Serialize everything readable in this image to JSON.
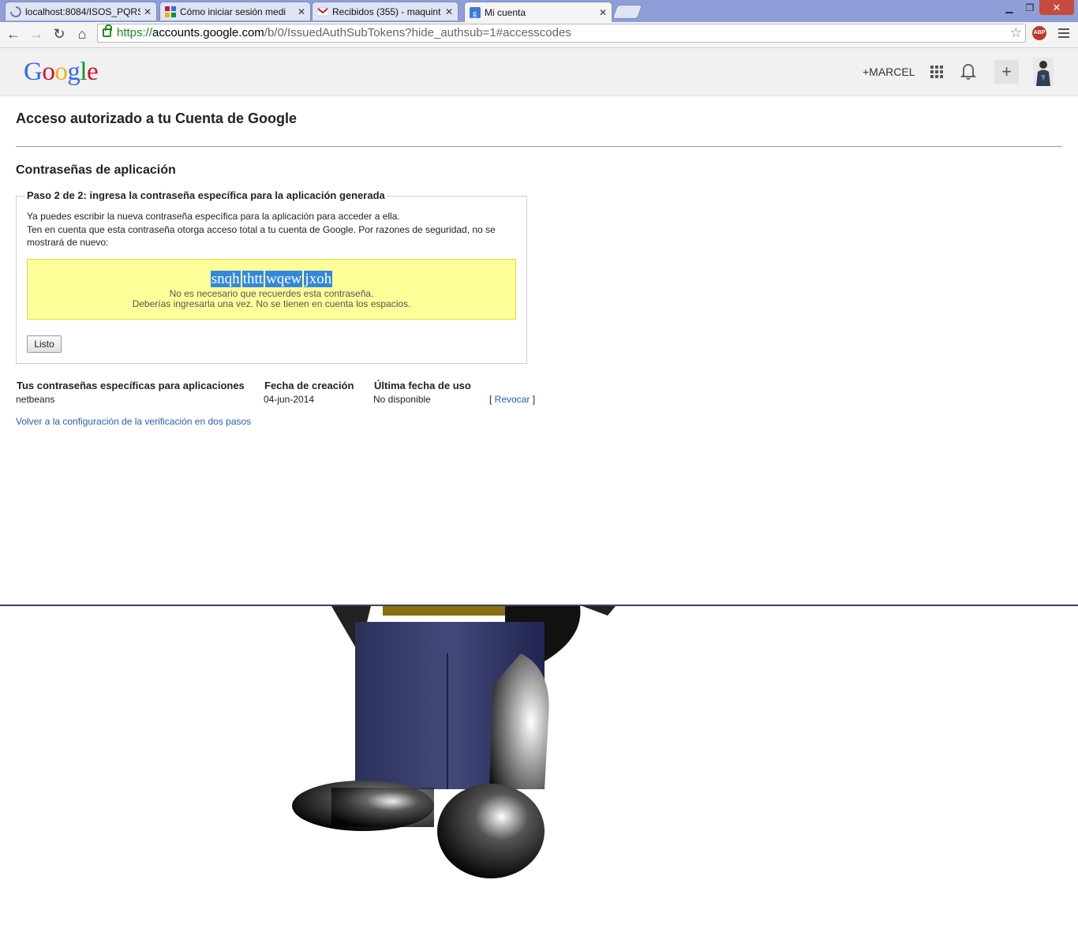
{
  "browser": {
    "tabs": [
      {
        "title": "localhost:8084/ISOS_PQRS",
        "icon": "loading-icon",
        "active": false
      },
      {
        "title": "Cómo iniciar sesión medi",
        "icon": "google-sites-icon",
        "active": false
      },
      {
        "title": "Recibidos (355) - maquint",
        "icon": "gmail-icon",
        "active": false
      },
      {
        "title": "Mi cuenta",
        "icon": "google-g-icon",
        "active": true
      }
    ],
    "url": {
      "scheme": "https://",
      "host": "accounts.google.com",
      "rest": "/b/0/IssuedAuthSubTokens?hide_authsub=1#accesscodes"
    },
    "extension_badge": "ABP"
  },
  "google_header": {
    "logo_letters": [
      {
        "ch": "G",
        "color": "#3369e8"
      },
      {
        "ch": "o",
        "color": "#d50f25"
      },
      {
        "ch": "o",
        "color": "#eeb211"
      },
      {
        "ch": "g",
        "color": "#3369e8"
      },
      {
        "ch": "l",
        "color": "#009925"
      },
      {
        "ch": "e",
        "color": "#d50f25"
      }
    ],
    "plus_name": "+MARCEL"
  },
  "page": {
    "title": "Acceso autorizado a tu Cuenta de Google",
    "section_title": "Contraseñas de aplicación",
    "step_legend": "Paso 2 de 2: ingresa la contraseña específica para la aplicación generada",
    "intro_line1": "Ya puedes escribir la nueva contraseña específica para la aplicación para acceder a ella.",
    "intro_line2": "Ten en cuenta que esta contraseña otorga acceso total a tu cuenta de Google. Por razones de seguridad, no se mostrará de nuevo:",
    "password_groups": [
      "snqh",
      "thtt",
      "wqew",
      "jxoh"
    ],
    "password_note1": "No es necesario que recuerdes esta contraseña.",
    "password_note2": "Deberías ingresarla una vez. No se tienen en cuenta los espacios.",
    "done_button": "Listo"
  },
  "passwords_table": {
    "headers": [
      "Tus contraseñas específicas para aplicaciones",
      "Fecha de creación",
      "Última fecha de uso"
    ],
    "rows": [
      {
        "name": "netbeans",
        "created": "04-jun-2014",
        "last_used": "No disponible",
        "action": "Revocar"
      }
    ]
  },
  "back_link": "Volver a la configuración de la verificación en dos pasos"
}
